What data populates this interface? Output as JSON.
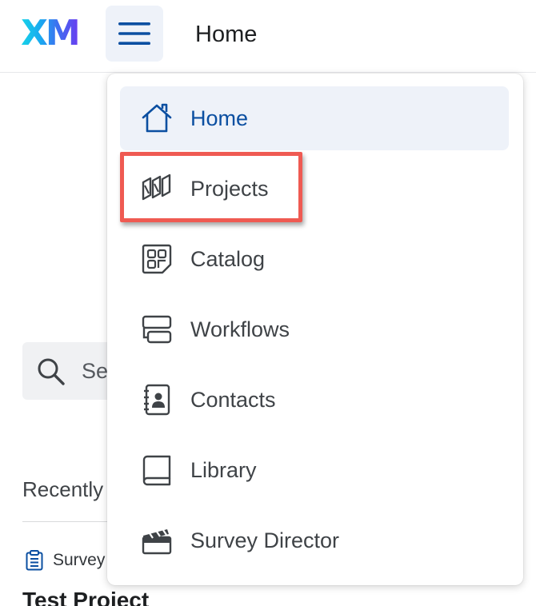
{
  "header": {
    "logo_text": "XM",
    "title": "Home",
    "menu_button_icon": "hamburger-menu-icon"
  },
  "background_page": {
    "search_placeholder": "Se",
    "recently_label": "Recently",
    "survey_type_label": "Survey",
    "project_title": "Test Project"
  },
  "menu": {
    "items": [
      {
        "label": "Home",
        "icon": "home-icon",
        "active": true
      },
      {
        "label": "Projects",
        "icon": "projects-icon",
        "active": false,
        "highlighted": true
      },
      {
        "label": "Catalog",
        "icon": "catalog-icon",
        "active": false
      },
      {
        "label": "Workflows",
        "icon": "workflows-icon",
        "active": false
      },
      {
        "label": "Contacts",
        "icon": "contacts-icon",
        "active": false
      },
      {
        "label": "Library",
        "icon": "library-icon",
        "active": false
      },
      {
        "label": "Survey Director",
        "icon": "clapperboard-icon",
        "active": false
      }
    ]
  },
  "colors": {
    "active_item_bg": "#eef2f9",
    "active_text": "#0b4fa1",
    "highlight_border": "#ef5a52",
    "icon_color": "#3f4347"
  }
}
